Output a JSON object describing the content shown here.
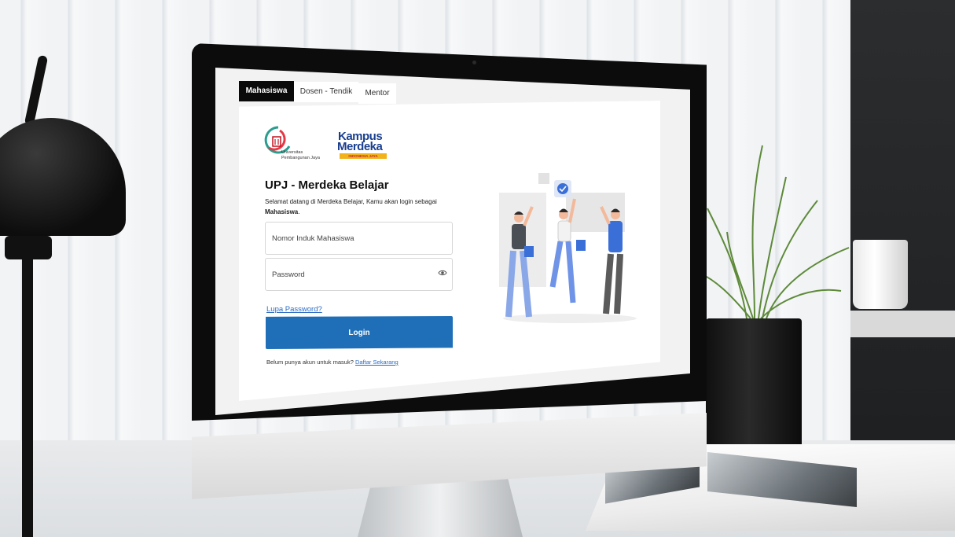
{
  "tabs": [
    {
      "label": "Mahasiswa",
      "active": true
    },
    {
      "label": "Dosen - Tendik",
      "active": false
    },
    {
      "label": "Mentor",
      "active": false
    }
  ],
  "logos": {
    "upj_line1": "Universitas",
    "upj_line2": "Pembangunan Jaya",
    "km_word1": "Kampus",
    "km_word2": "Merdeka",
    "km_band": "INDONESIA JAYA"
  },
  "login": {
    "title": "UPJ - Merdeka Belajar",
    "intro_text": "Selamat datang di Merdeka Belajar, Kamu akan login sebagai",
    "role": "Mahasiswa",
    "nim_placeholder": "Nomor Induk Mahasiswa",
    "password_placeholder": "Password",
    "forgot_label": "Lupa Password?",
    "login_label": "Login",
    "signup_prompt": "Belum punya akun untuk masuk?",
    "signup_link": "Daftar Sekarang"
  },
  "colors": {
    "primary": "#1f6fb8",
    "link": "#2b6cc4",
    "active_tab": "#0a0a0a",
    "km_blue": "#1a3f8f",
    "km_yellow": "#f2b21b"
  },
  "icons": [
    "upj-logo-icon",
    "kampus-merdeka-logo-icon",
    "eye-icon",
    "checkmark-badge-icon"
  ]
}
